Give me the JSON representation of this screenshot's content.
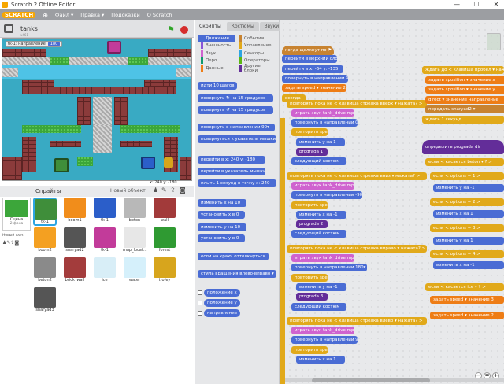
{
  "window": {
    "title": "Scratch 2 Offline Editor",
    "min": "—",
    "max": "☐",
    "close": "✕"
  },
  "menu": {
    "logo": "SCRATCH",
    "file": "Файл ▾",
    "edit": "Правка ▾",
    "tips": "Подсказки",
    "about": "О Scratch"
  },
  "stage": {
    "name": "tanks",
    "version": "v461",
    "hud_label": "tk-1: направление",
    "hud_value": "180",
    "coords": "x: 240  y: -180"
  },
  "sprites_panel": {
    "title": "Спрайты",
    "new_sprite": "Новый объект:",
    "stage_label": "Сцена",
    "stage_sub": "2 фона",
    "new_backdrop": "Новый фон:",
    "items": [
      {
        "name": "tk-1",
        "color": "#3f8e3a"
      },
      {
        "name": "boom1",
        "color": "#f18d1b"
      },
      {
        "name": "tk-1",
        "color": "#2b5ec9"
      },
      {
        "name": "beton",
        "color": "#b8b8b8"
      },
      {
        "name": "wall",
        "color": "#a23a3a"
      },
      {
        "name": "boom2",
        "color": "#f4a021"
      },
      {
        "name": "snaryad2",
        "color": "#555555"
      },
      {
        "name": "tk-1",
        "color": "#c23b9a"
      },
      {
        "name": "map_locat...",
        "color": "#e7e7e7"
      },
      {
        "name": "forest",
        "color": "#2f9a32"
      },
      {
        "name": "beton2",
        "color": "#8a8a8a"
      },
      {
        "name": "brick_wall",
        "color": "#a33c3c"
      },
      {
        "name": "ice",
        "color": "#d8eef7"
      },
      {
        "name": "water",
        "color": "#d5f0fb"
      },
      {
        "name": "trofey",
        "color": "#d7a51d"
      },
      {
        "name": "snaryad3",
        "color": "#555555"
      }
    ]
  },
  "palette": {
    "tabs": [
      "Скрипты",
      "Костюмы",
      "Звуки"
    ],
    "categories_left": [
      {
        "label": "Движение",
        "color": "#4a6cd4"
      },
      {
        "label": "Внешность",
        "color": "#8a55d7"
      },
      {
        "label": "Звук",
        "color": "#cf63cf"
      },
      {
        "label": "Перо",
        "color": "#0e9a6c"
      },
      {
        "label": "Данные",
        "color": "#ee7d16"
      }
    ],
    "categories_right": [
      {
        "label": "События",
        "color": "#c88330"
      },
      {
        "label": "Управление",
        "color": "#e1a91a"
      },
      {
        "label": "Сенсоры",
        "color": "#2ca5e2"
      },
      {
        "label": "Операторы",
        "color": "#5cb712"
      },
      {
        "label": "Другие блоки",
        "color": "#632d99"
      }
    ],
    "blocks": [
      "идти 10 шагов",
      "повернуть ↻ на 15 градусов",
      "повернуть ↺ на 15 градусов",
      "повернуть в направлении 90▾",
      "повернуться к указатель мышки ▾",
      "перейти в x: 240 y: -180",
      "перейти в указатель мышки ▾",
      "плыть 1 секунд в точку x: 240",
      "изменить х на 10",
      "установить х в 0",
      "изменить у на 10",
      "установить у в 0",
      "если на краю, оттолкнуться",
      "стиль вращения влево-вправо ▾"
    ],
    "reporters": [
      "положение х",
      "положение у",
      "направление"
    ]
  },
  "scripts": {
    "main": [
      {
        "text": "когда щелкнут по ⚑",
        "cls": "b-evt"
      },
      {
        "text": "перейти в верхний слой",
        "cls": "b-mot"
      },
      {
        "text": "перейти в x: -64 y: -135",
        "cls": "b-mot"
      },
      {
        "text": "повернуть в направлении 90▾",
        "cls": "b-mot"
      },
      {
        "text": "задать speed ▾ значение 2",
        "cls": "b-data"
      },
      {
        "text": "всегда",
        "cls": "b-ctl"
      },
      {
        "text": "повторять пока не < клавиша стрелка вверх ▾ нажата? >",
        "cls": "b-ctl"
      },
      {
        "text": "играть звук tank_drive.mp3 ▾",
        "cls": "b-snd"
      },
      {
        "text": "повернуть в направлении 0▾",
        "cls": "b-mot"
      },
      {
        "text": "повторить speed",
        "cls": "b-ctl"
      },
      {
        "text": "изменить у на 1",
        "cls": "b-mot"
      },
      {
        "text": "prograda 1",
        "cls": "b-more"
      },
      {
        "text": "следующий костюм",
        "cls": "b-mot"
      },
      {
        "text": "повторять пока не < клавиша стрелка вниз ▾ нажата? >",
        "cls": "b-ctl"
      },
      {
        "text": "играть звук tank_drive.mp3 ▾",
        "cls": "b-snd"
      },
      {
        "text": "повернуть в направлении -90▾",
        "cls": "b-mot"
      },
      {
        "text": "повторить speed",
        "cls": "b-ctl"
      },
      {
        "text": "изменить х на -1",
        "cls": "b-mot"
      },
      {
        "text": "prograda 2",
        "cls": "b-more"
      },
      {
        "text": "следующий костюм",
        "cls": "b-mot"
      },
      {
        "text": "повторять пока не < клавиша стрелка вправо ▾ нажата? >",
        "cls": "b-ctl"
      },
      {
        "text": "играть звук tank_drive.mp3 ▾",
        "cls": "b-snd"
      },
      {
        "text": "повернуть в направлении 180▾",
        "cls": "b-mot"
      },
      {
        "text": "повторить speed",
        "cls": "b-ctl"
      },
      {
        "text": "изменить у на -1",
        "cls": "b-mot"
      },
      {
        "text": "prograda 3",
        "cls": "b-more"
      },
      {
        "text": "следующий костюм",
        "cls": "b-mot"
      },
      {
        "text": "повторять пока не < клавиша стрелка влево ▾ нажата? >",
        "cls": "b-ctl"
      },
      {
        "text": "играть звук tank_drive.mp3 ▾",
        "cls": "b-snd"
      },
      {
        "text": "повернуть в направлении 90▾",
        "cls": "b-mot"
      },
      {
        "text": "повторить speed",
        "cls": "b-ctl"
      },
      {
        "text": "изменить х на 1",
        "cls": "b-mot"
      }
    ],
    "right_top": [
      {
        "text": "ждать до < клавиша пробел ▾ нажата? >",
        "cls": "b-ctl"
      },
      {
        "text": "задать sposition ▾ значение x",
        "cls": "b-data"
      },
      {
        "text": "задать sposition ▾ значение y",
        "cls": "b-data"
      },
      {
        "text": "direct ▾ значение направление",
        "cls": "b-data"
      },
      {
        "text": "передать snaryad2 ▾",
        "cls": "b-evt"
      },
      {
        "text": "ждать 1 секунд",
        "cls": "b-ctl"
      }
    ],
    "right_def": {
      "text": "определить prograda dir",
      "cls": "b-more"
    },
    "right_mid": [
      {
        "text": "если < касается beton ▾ ? >",
        "cls": "b-ctl"
      },
      {
        "text": "если < options = 1 >",
        "cls": "b-ctl"
      },
      {
        "text": "изменить у на -1",
        "cls": "b-mot"
      },
      {
        "text": "если < options = 2 >",
        "cls": "b-ctl"
      },
      {
        "text": "изменить х на 1",
        "cls": "b-mot"
      },
      {
        "text": "если < options = 3 >",
        "cls": "b-ctl"
      },
      {
        "text": "изменить у на 1",
        "cls": "b-mot"
      },
      {
        "text": "если < options = 4 >",
        "cls": "b-ctl"
      },
      {
        "text": "изменить х на -1",
        "cls": "b-mot"
      },
      {
        "text": "если < касается ice ▾ ? >",
        "cls": "b-ctl"
      },
      {
        "text": "задать speed ▾ значение 3",
        "cls": "b-data"
      },
      {
        "text": "задать speed ▾ значение 2",
        "cls": "b-data"
      }
    ],
    "zoom": {
      "out": "−",
      "reset": "=",
      "in": "+"
    }
  }
}
